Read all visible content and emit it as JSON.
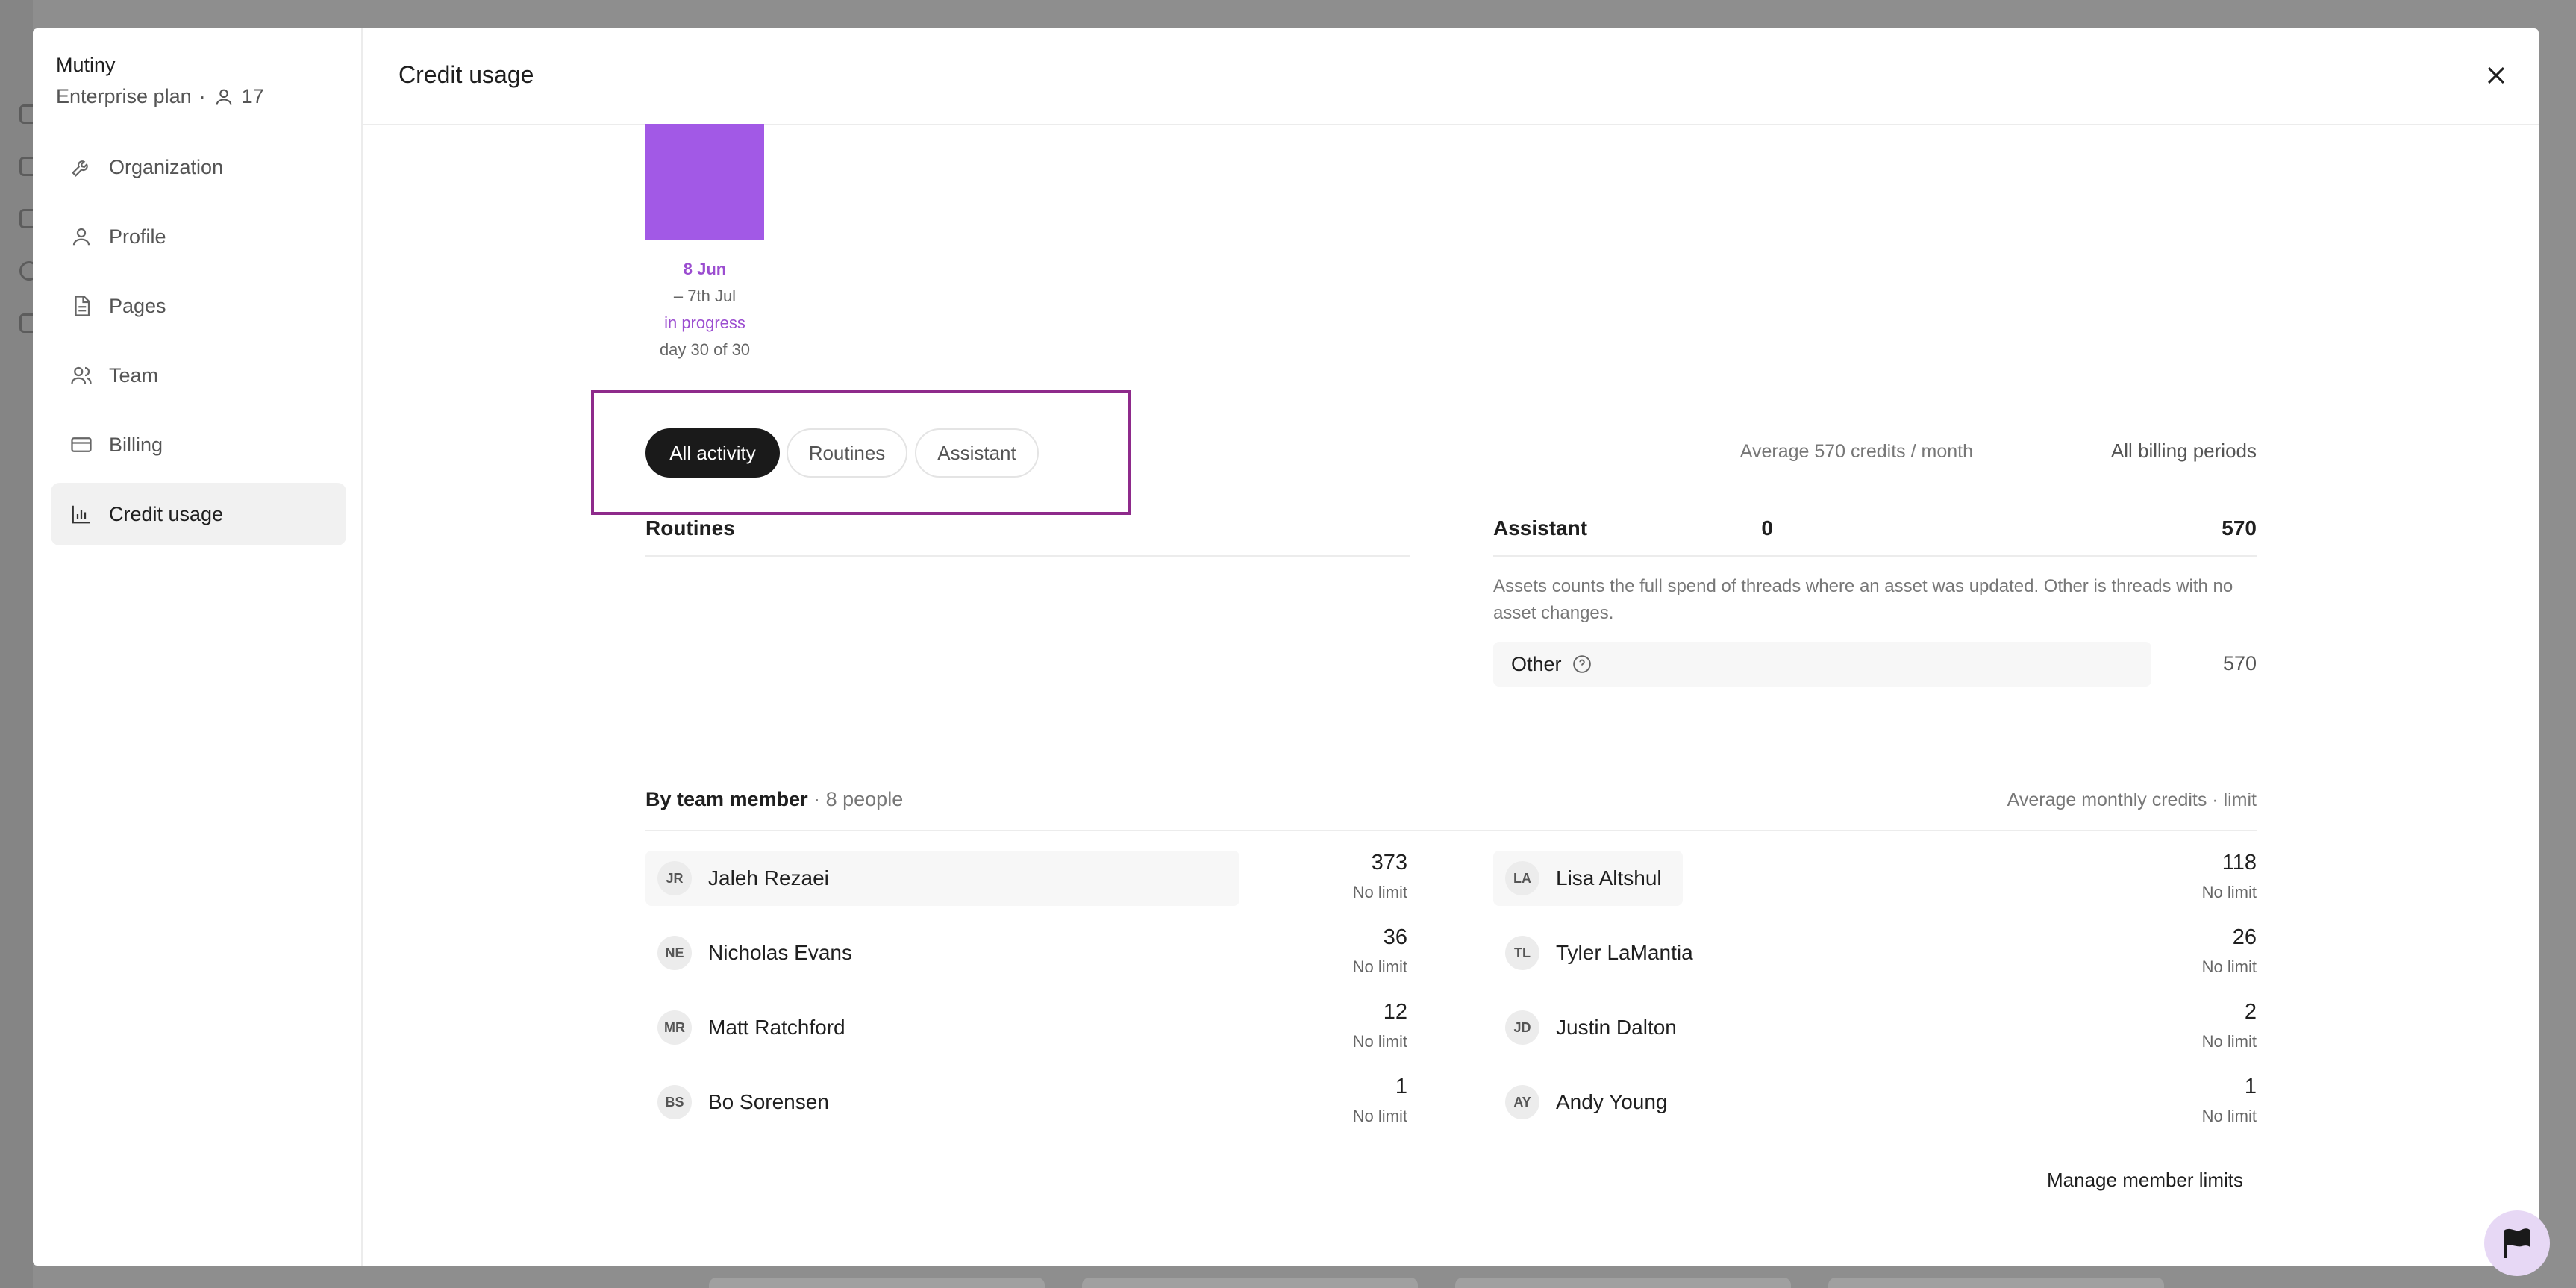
{
  "org": {
    "name": "Mutiny",
    "plan": "Enterprise plan",
    "separator": "·",
    "members": "17"
  },
  "nav": [
    {
      "label": "Organization",
      "icon": "wrench-icon"
    },
    {
      "label": "Profile",
      "icon": "user-icon"
    },
    {
      "label": "Pages",
      "icon": "document-icon"
    },
    {
      "label": "Team",
      "icon": "users-icon"
    },
    {
      "label": "Billing",
      "icon": "credit-card-icon"
    },
    {
      "label": "Credit usage",
      "icon": "bar-chart-icon",
      "active": true
    }
  ],
  "header": {
    "title": "Credit usage"
  },
  "period": {
    "start": "8 Jun",
    "end": "– 7th Jul",
    "status": "in progress",
    "day": "day 30 of 30"
  },
  "filters": {
    "all": "All activity",
    "routines": "Routines",
    "assistant": "Assistant"
  },
  "summary": {
    "average": "Average 570 credits / month",
    "periods": "All billing periods"
  },
  "routines": {
    "label": "Routines",
    "value": "0"
  },
  "assistant": {
    "label": "Assistant",
    "value": "570",
    "description": "Assets counts the full spend of threads where an asset was updated. Other is threads with no asset changes.",
    "other_label": "Other",
    "other_value": "570"
  },
  "team": {
    "title": "By team member",
    "count": "· 8 people",
    "right_label": "Average monthly credits · limit",
    "members": [
      {
        "initials": "JR",
        "name": "Jaleh Rezaei",
        "value": "373",
        "limit": "No limit"
      },
      {
        "initials": "LA",
        "name": "Lisa Altshul",
        "value": "118",
        "limit": "No limit"
      },
      {
        "initials": "NE",
        "name": "Nicholas Evans",
        "value": "36",
        "limit": "No limit"
      },
      {
        "initials": "TL",
        "name": "Tyler LaMantia",
        "value": "26",
        "limit": "No limit"
      },
      {
        "initials": "MR",
        "name": "Matt Ratchford",
        "value": "12",
        "limit": "No limit"
      },
      {
        "initials": "JD",
        "name": "Justin Dalton",
        "value": "2",
        "limit": "No limit"
      },
      {
        "initials": "BS",
        "name": "Bo Sorensen",
        "value": "1",
        "limit": "No limit"
      },
      {
        "initials": "AY",
        "name": "Andy Young",
        "value": "1",
        "limit": "No limit"
      }
    ],
    "manage_label": "Manage member limits"
  },
  "colors": {
    "accent": "#a259e6",
    "highlight": "#8e2a8b",
    "active_chip": "#1a1a1a"
  }
}
